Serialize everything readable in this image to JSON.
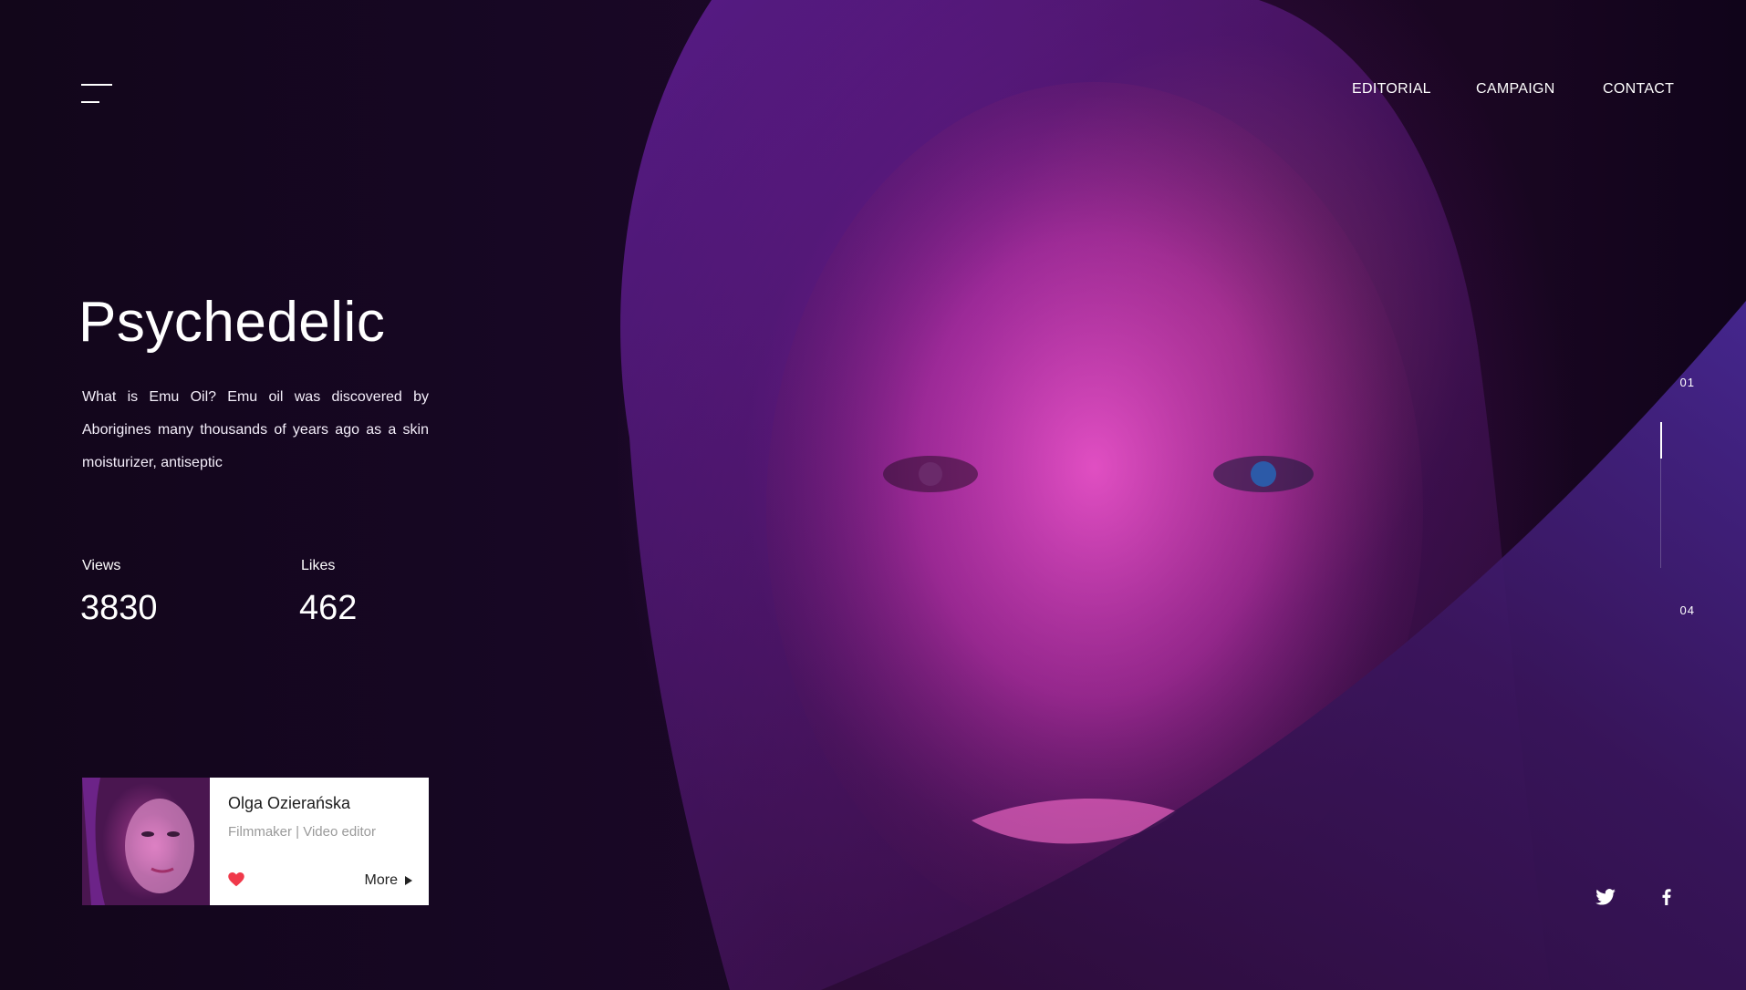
{
  "header": {
    "nav": [
      {
        "label": "EDITORIAL"
      },
      {
        "label": "CAMPAIGN"
      },
      {
        "label": "CONTACT"
      }
    ]
  },
  "hero": {
    "title": "Psychedelic",
    "description": "What is Emu Oil? Emu oil was discovered by Aborigines many thousands of years ago as a skin moisturizer, antiseptic"
  },
  "stats": [
    {
      "label": "Views",
      "value": "3830"
    },
    {
      "label": "Likes",
      "value": "462"
    }
  ],
  "author": {
    "name": "Olga Ozierańska",
    "role": "Filmmaker | Video editor",
    "more_label": "More",
    "liked": true
  },
  "pager": {
    "current": "01",
    "total": "04",
    "progress": 0.25
  },
  "social": [
    {
      "icon": "twitter-icon"
    },
    {
      "icon": "facebook-icon"
    }
  ],
  "colors": {
    "heart": "#f0394a",
    "accent_magenta": "#e83ac8"
  }
}
